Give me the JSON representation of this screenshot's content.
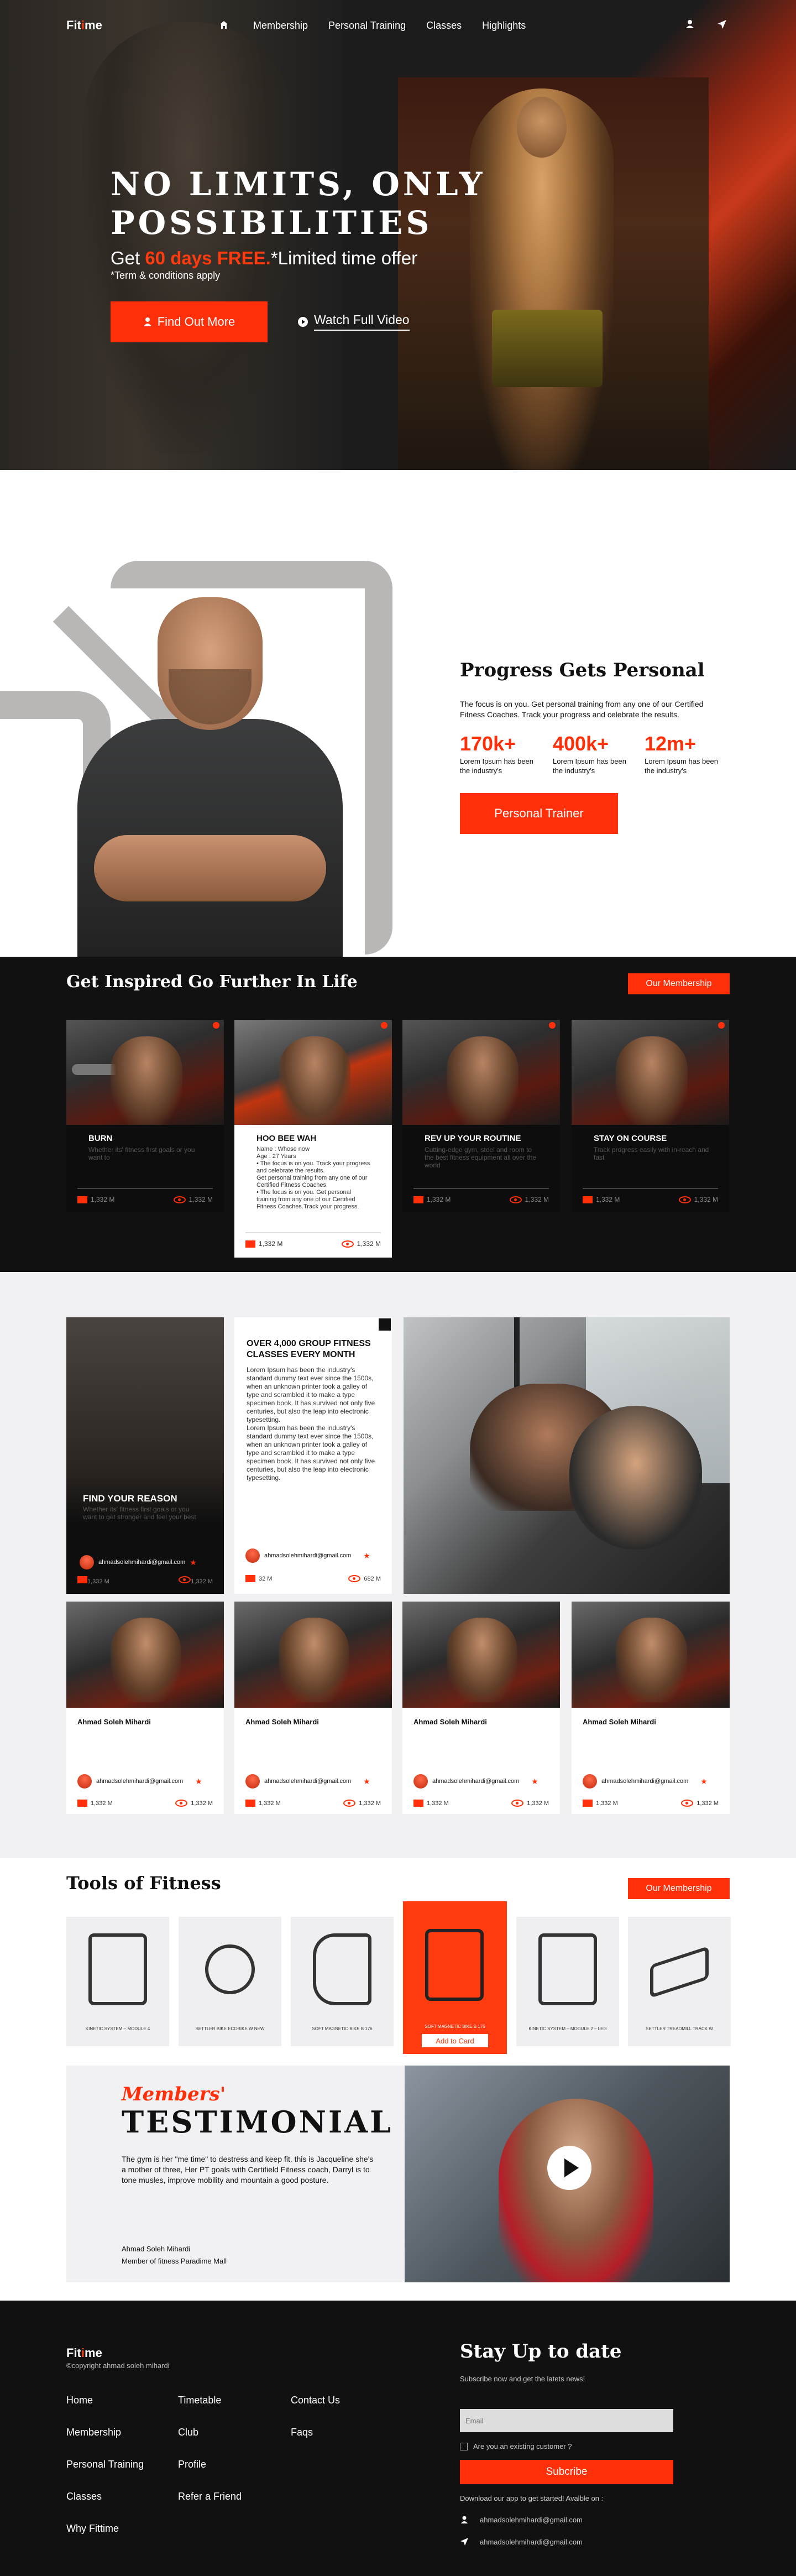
{
  "nav": {
    "logo_a": "Fit",
    "logo_b": "i",
    "logo_c": "me",
    "menu": [
      "Membership",
      "Personal Training",
      "Classes",
      "Highlights"
    ],
    "icons": [
      "home-icon",
      "user-icon",
      "send-icon"
    ]
  },
  "hero": {
    "title": "NO LIMITS, ONLY POSSIBILITIES",
    "offer_pre": "Get ",
    "offer_hl": "60 days FREE.",
    "offer_post": "*Limited time offer",
    "terms": "*Term & conditions apply",
    "find_out": "Find Out More",
    "watch": "Watch Full Video"
  },
  "progress": {
    "title": "Progress Gets Personal",
    "desc": "The focus is on you. Get personal training from any one of our Certified Fitness Coaches. Track your progress and celebrate the results.",
    "stats": [
      {
        "num": "170k+",
        "label": "Lorem Ipsum has been the industry's"
      },
      {
        "num": "400k+",
        "label": "Lorem Ipsum has been the industry's"
      },
      {
        "num": "12m+",
        "label": "Lorem Ipsum has been the industry's"
      }
    ],
    "button": "Personal Trainer"
  },
  "inspired": {
    "title": "Get Inspired Go Further In Life",
    "button": "Our Membership",
    "cards": [
      {
        "title": "BURN",
        "desc": "Whether its' fitness first goals or you want to",
        "mail": "1,332 M",
        "views": "1,332 M"
      },
      {
        "title": "HOO BEE WAH",
        "desc": "Name : Whose now\nAge : 27 Years\n• The focus is on you. Track your progress and celebrate the results.\nGet personal training from any one of our Certified Fitness Coaches.\n• The focus is on you. Get personal training from any one of our Certified Fitness Coaches.Track your progress.",
        "mail": "1,332 M",
        "views": "1,332 M"
      },
      {
        "title": "REV UP YOUR ROUTINE",
        "desc": "Cutting-edge gym, steel and room to the best fitness equipment all over the world",
        "mail": "1,332 M",
        "views": "1,332 M"
      },
      {
        "title": "STAY ON COURSE",
        "desc": "Track progress easily with in-reach and fast",
        "mail": "1,332 M",
        "views": "1,332 M"
      }
    ]
  },
  "classes": {
    "reason": {
      "title": "FIND YOUR REASON",
      "desc": "Whether its' fitness first goals or you want to get stronger and feel your best",
      "email": "ahmadsolehmihardi@gmail.com",
      "mail": "1,332 M",
      "views": "1,332 M"
    },
    "overview": {
      "title": "OVER 4,000 GROUP FITNESS CLASSES EVERY MONTH",
      "body": "Lorem Ipsum has been the industry's standard dummy text ever since the 1500s, when an unknown printer took a galley of type and scrambled it to make a type specimen book. It has survived not only five centuries, but also the leap into electronic typesetting.\nLorem Ipsum has been the industry's standard dummy text ever since the 1500s, when an unknown printer took a galley of type and scrambled it to make a type specimen book. It has survived not only five centuries, but also the leap into electronic typesetting.",
      "email": "ahmadsolehmihardi@gmail.com",
      "mail": "32 M",
      "views": "682 M"
    },
    "people": [
      {
        "name": "Ahmad Soleh Mihardi",
        "email": "ahmadsolehmihardi@gmail.com",
        "mail": "1,332 M",
        "views": "1,332 M"
      },
      {
        "name": "Ahmad Soleh Mihardi",
        "email": "ahmadsolehmihardi@gmail.com",
        "mail": "1,332 M",
        "views": "1,332 M"
      },
      {
        "name": "Ahmad Soleh Mihardi",
        "email": "ahmadsolehmihardi@gmail.com",
        "mail": "1,332 M",
        "views": "1,332 M"
      },
      {
        "name": "Ahmad Soleh Mihardi",
        "email": "ahmadsolehmihardi@gmail.com",
        "mail": "1,332 M",
        "views": "1,332 M"
      }
    ]
  },
  "tools": {
    "title": "Tools of Fitness",
    "button": "Our Membership",
    "items": [
      {
        "caption": "KINETIC SYSTEM – MODULE 4"
      },
      {
        "caption": "SETTLER BIKE ECOBIKE W NEW"
      },
      {
        "caption": "SOFT MAGNETIC BIKE B 176"
      },
      {
        "caption": "SOFT MAGNETIC BIKE B 176",
        "add": "Add to Card"
      },
      {
        "caption": "KINETIC SYSTEM – MODULE 2 – LEG"
      },
      {
        "caption": "SETTLER TREADMILL TRACK W"
      }
    ]
  },
  "testimonial": {
    "members": "Members'",
    "title": "TESTIMONIAL",
    "quote": "The gym is her \"me time\" to destress and keep fit. this is Jacqueline she's a mother of three, Her PT goals with Certifield Fitness coach, Darryl is to tone musles, improve mobility and mountain a good posture.",
    "name": "Ahmad Soleh Mihardi",
    "role": "Member  of fitness Paradime Mall"
  },
  "footer": {
    "logo_a": "Fit",
    "logo_b": "i",
    "logo_c": "me",
    "copyright": "©copyright ahmad soleh mihardi",
    "col1": [
      "Home",
      "Membership",
      "Personal Training",
      "Classes",
      "Why Fittime"
    ],
    "col2": [
      "Timetable",
      "Club",
      "Profile",
      "Refer a Friend"
    ],
    "col3": [
      "Contact Us",
      "Faqs"
    ],
    "stay_title": "Stay Up to date",
    "subscribe_text": "Subscribe now and get the latets news!",
    "email_placeholder": "Email",
    "existing": "Are you an existing customer ?",
    "subscribe_btn": "Subcribe",
    "download": "Download our app to get started! Avalble on :",
    "contact_email": "ahmadsolehmihardi@gmail.com",
    "contact_email2": "ahmadsolehmihardi@gmail.com"
  },
  "colors": {
    "accent": "#ff2f0a",
    "dark": "#111111",
    "light_bg": "#f1f1f3"
  }
}
